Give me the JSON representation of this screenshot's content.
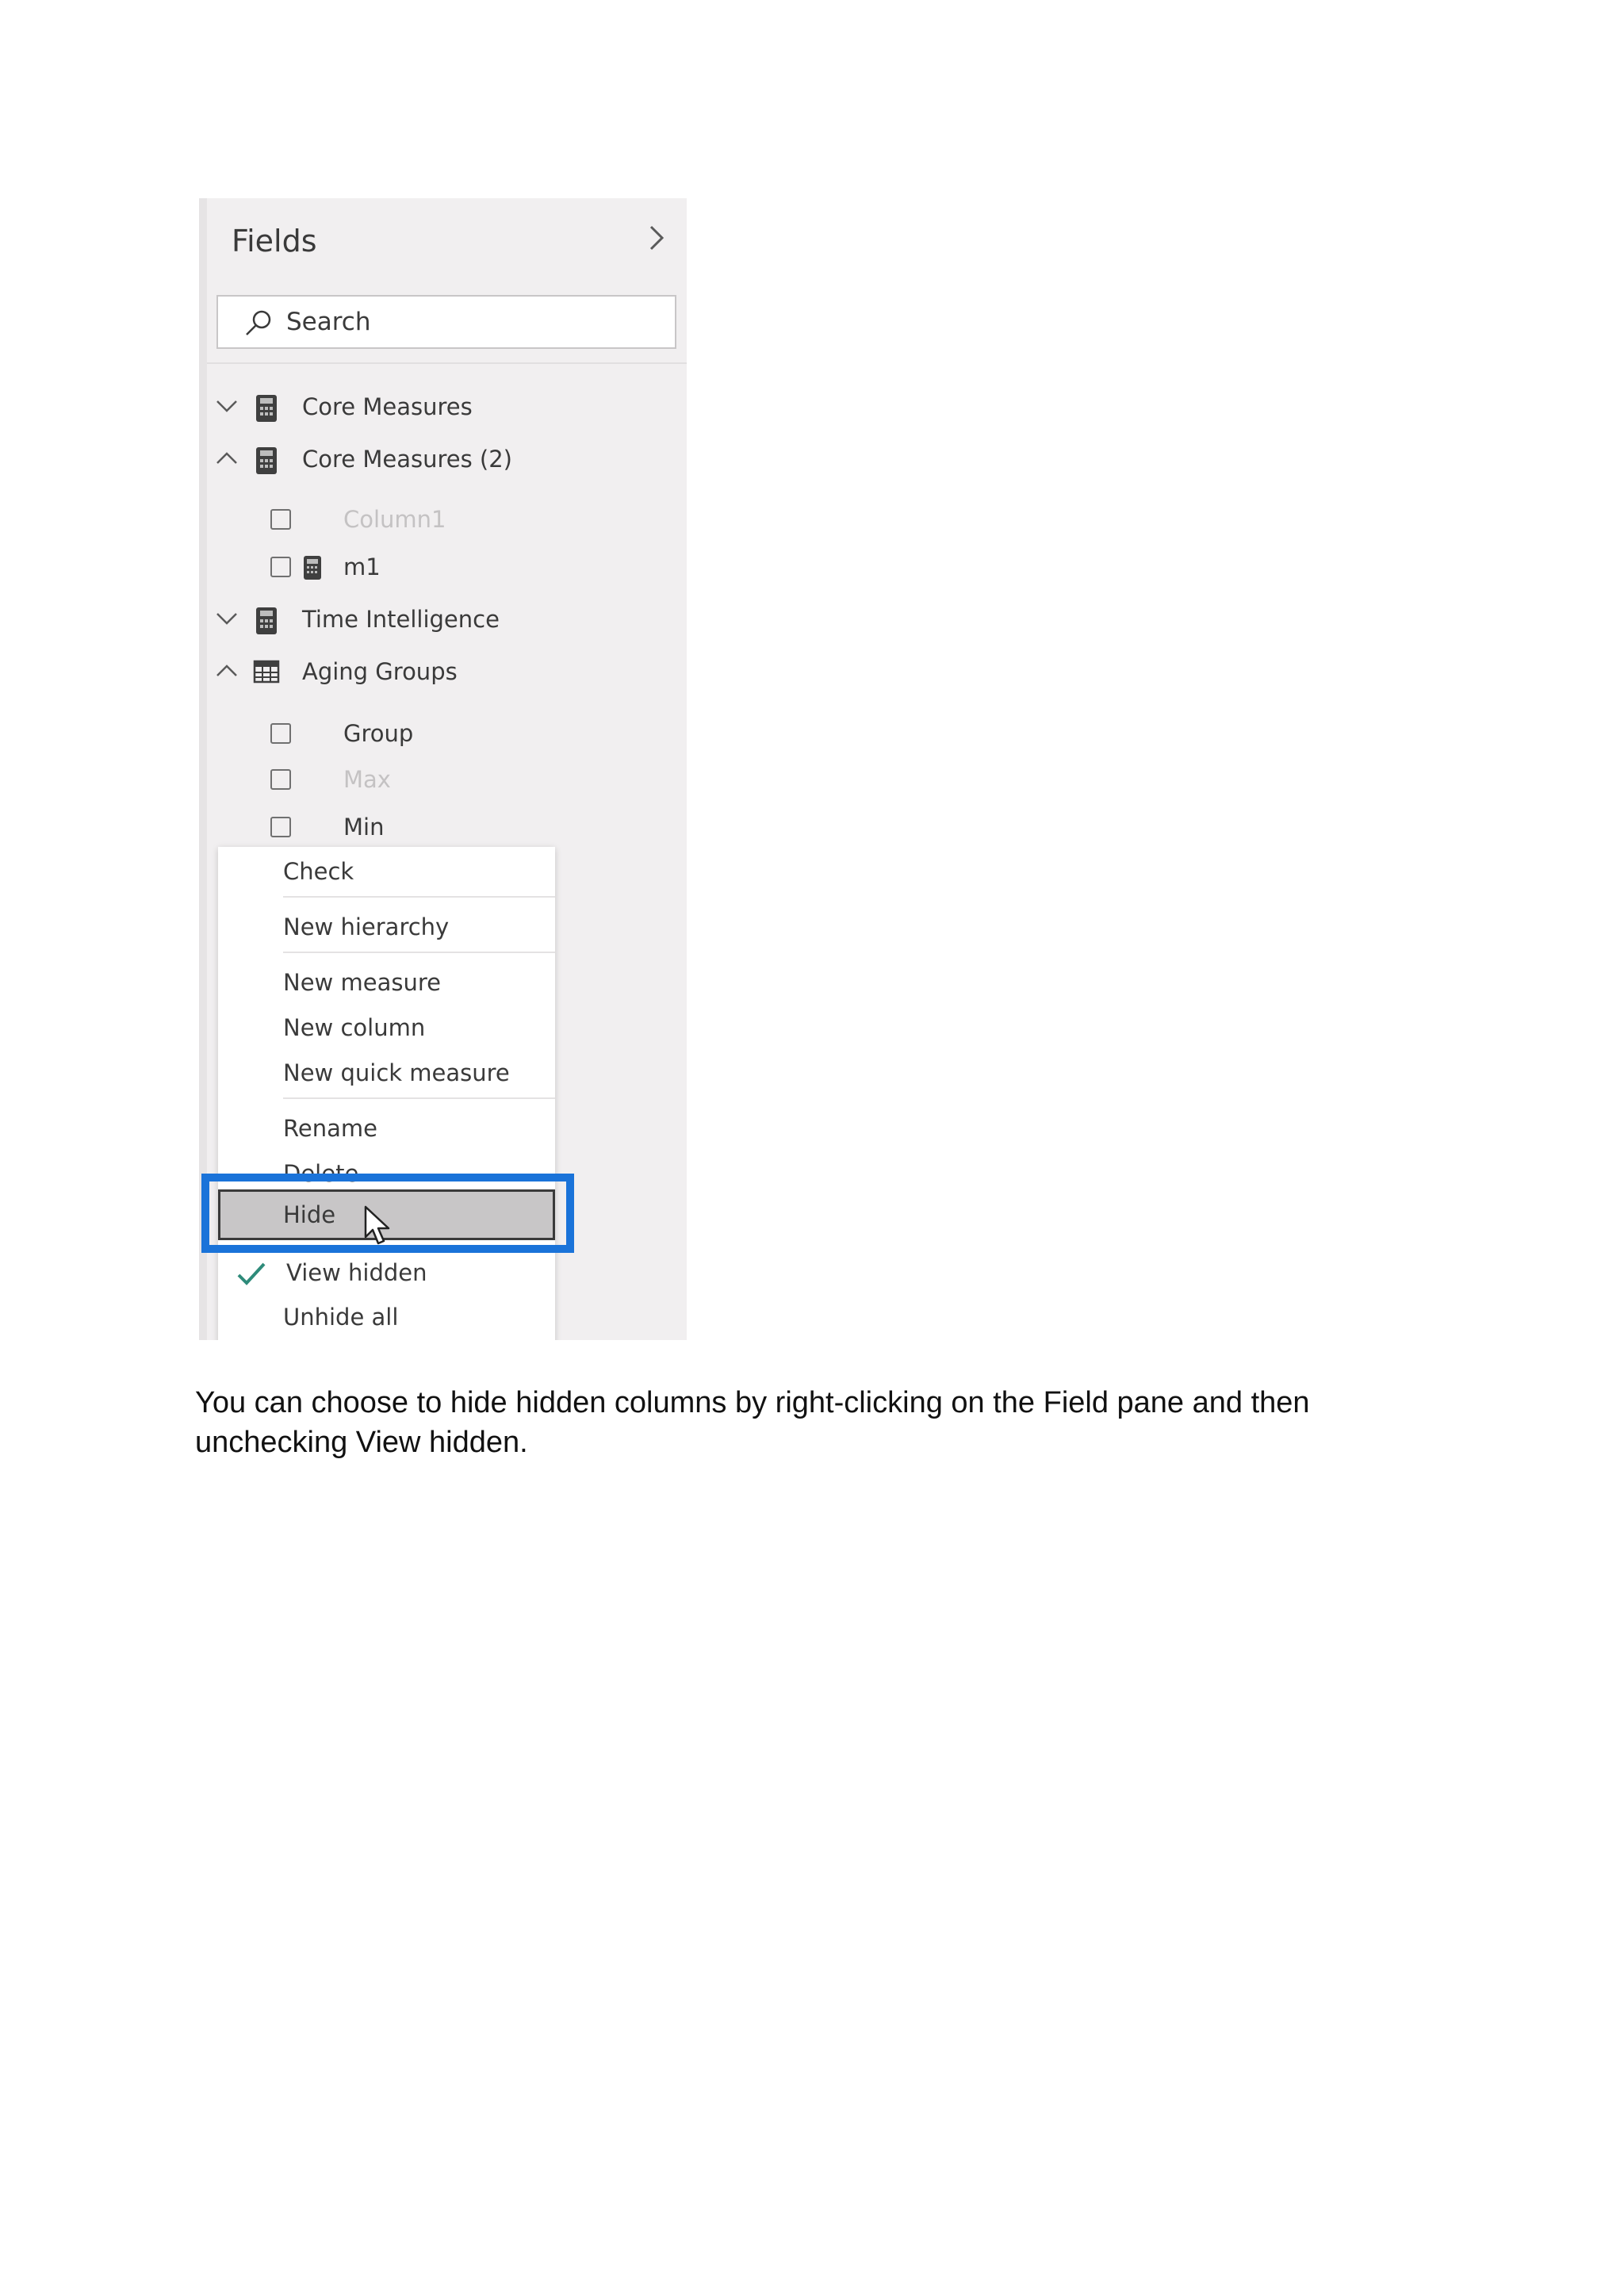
{
  "fields_pane": {
    "title": "Fields",
    "collapse_icon": "chevron-right-icon",
    "search": {
      "placeholder": "Search",
      "value": "",
      "icon": "search-icon"
    },
    "tables": [
      {
        "label": "Core Measures",
        "expanded": false,
        "icon": "calculator-icon"
      },
      {
        "label": "Core Measures (2)",
        "expanded": true,
        "icon": "calculator-icon",
        "fields": [
          {
            "label": "Column1",
            "hidden": true,
            "checked": false
          },
          {
            "label": "m1",
            "hidden": false,
            "checked": false,
            "icon": "calculator-icon"
          }
        ]
      },
      {
        "label": "Time Intelligence",
        "expanded": false,
        "icon": "calculator-icon"
      },
      {
        "label": "Aging Groups",
        "expanded": true,
        "icon": "table-icon",
        "fields": [
          {
            "label": "Group",
            "hidden": false,
            "checked": false
          },
          {
            "label": "Max",
            "hidden": true,
            "checked": false
          },
          {
            "label": "Min",
            "hidden": false,
            "checked": false
          }
        ]
      }
    ]
  },
  "context_menu": {
    "items": [
      {
        "label": "Check"
      },
      {
        "label": "New hierarchy"
      },
      {
        "label": "New measure"
      },
      {
        "label": "New column"
      },
      {
        "label": "New quick measure"
      },
      {
        "label": "Rename"
      },
      {
        "label": "Delete"
      },
      {
        "label": "Hide",
        "hovered": true
      },
      {
        "label": "View hidden",
        "checked": true,
        "check_icon": "checkmark-icon"
      },
      {
        "label": "Unhide all"
      }
    ]
  },
  "colors": {
    "highlight_box": "#1a73d9",
    "checkmark": "#2e8b7a",
    "pane_background": "#f1eff0"
  },
  "caption": "You can choose to hide hidden columns by right-clicking on the Field pane and then unchecking View hidden."
}
